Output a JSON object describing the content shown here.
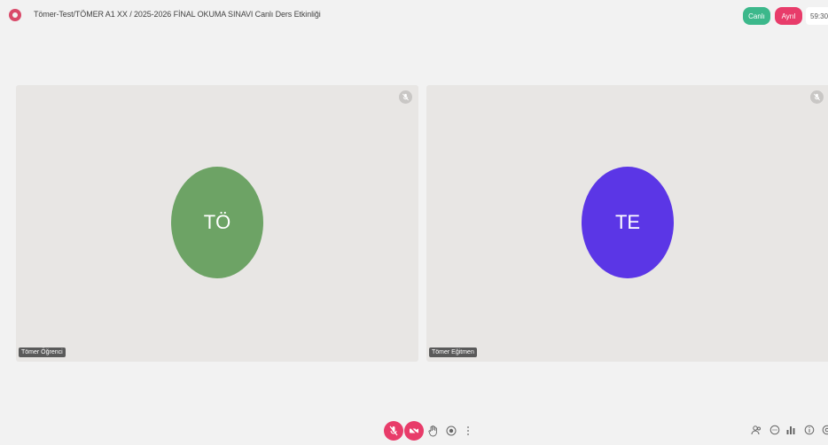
{
  "header": {
    "title": "Tömer-Test/TÖMER A1 XX / 2025-2026 FİNAL OKUMA SINAVI Canlı Ders Etkinliği",
    "live_label": "Canlı",
    "leave_label": "Ayrıl",
    "timer": "59:30"
  },
  "participants": [
    {
      "initials": "TÖ",
      "name": "Tömer Öğrenci",
      "color": "#6da365"
    },
    {
      "initials": "TE",
      "name": "Tömer Eğitmen",
      "color": "#5b36e6"
    }
  ],
  "colors": {
    "accent_live": "#3cb88b",
    "accent_leave": "#e83c6a",
    "background": "#f2f2f2",
    "tile": "#e8e6e4"
  },
  "toolbar": {
    "icons": [
      "mic-off-icon",
      "camera-off-icon",
      "raise-hand-icon",
      "screen-share-icon",
      "more-icon"
    ],
    "right_icons": [
      "participants-icon",
      "chat-icon",
      "stats-icon",
      "info-icon",
      "settings-icon"
    ]
  }
}
